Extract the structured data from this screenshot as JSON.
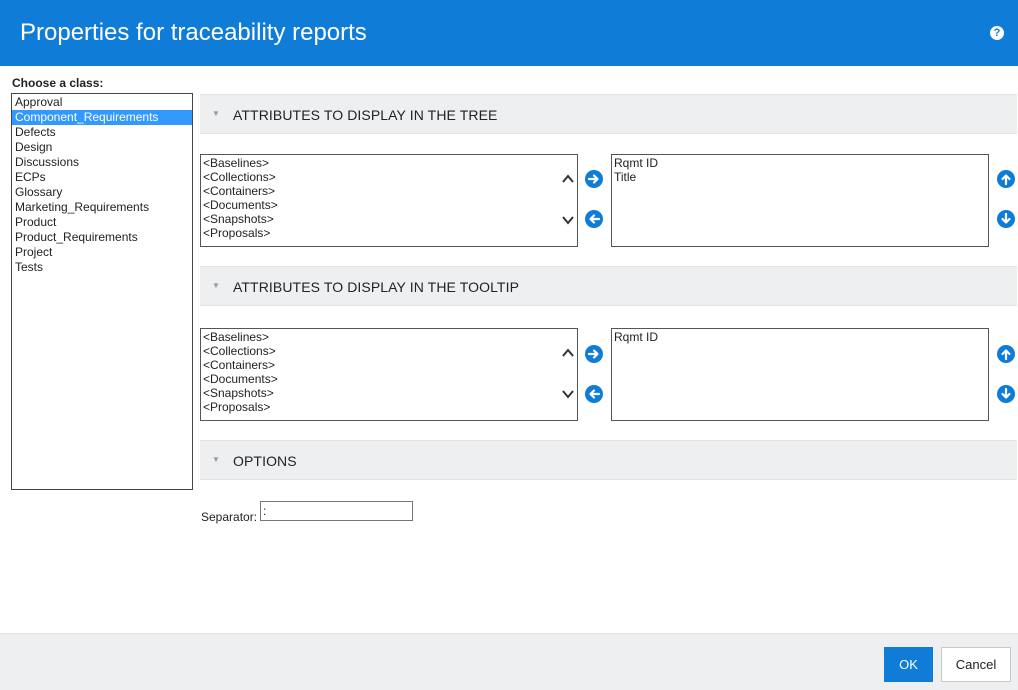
{
  "dialog": {
    "title": "Properties for traceability reports",
    "help_icon": "?"
  },
  "class_chooser": {
    "label": "Choose a class:",
    "items": [
      "Approval",
      "Component_Requirements",
      "Defects",
      "Design",
      "Discussions",
      "ECPs",
      "Glossary",
      "Marketing_Requirements",
      "Product",
      "Product_Requirements",
      "Project",
      "Tests"
    ],
    "selected": "Component_Requirements"
  },
  "tree_section": {
    "caret": "▼",
    "title": "ATTRIBUTES TO DISPLAY IN THE TREE",
    "available": [
      "<Baselines>",
      "<Collections>",
      "<Containers>",
      "<Documents>",
      "<Snapshots>",
      "<Proposals>"
    ],
    "selected": [
      "Rqmt ID",
      "Title"
    ]
  },
  "tooltip_section": {
    "caret": "▼",
    "title": "ATTRIBUTES TO DISPLAY IN THE TOOLTIP",
    "available": [
      "<Baselines>",
      "<Collections>",
      "<Containers>",
      "<Documents>",
      "<Snapshots>",
      "<Proposals>"
    ],
    "selected": [
      "Rqmt ID"
    ]
  },
  "options_section": {
    "caret": "▼",
    "title": "OPTIONS",
    "separator_label": "Separator:",
    "separator_value": ":"
  },
  "footer": {
    "ok_label": "OK",
    "cancel_label": "Cancel"
  },
  "colors": {
    "accent": "#0F7DD8",
    "selection": "#3399FF",
    "section_bg": "#EEEFF1"
  }
}
